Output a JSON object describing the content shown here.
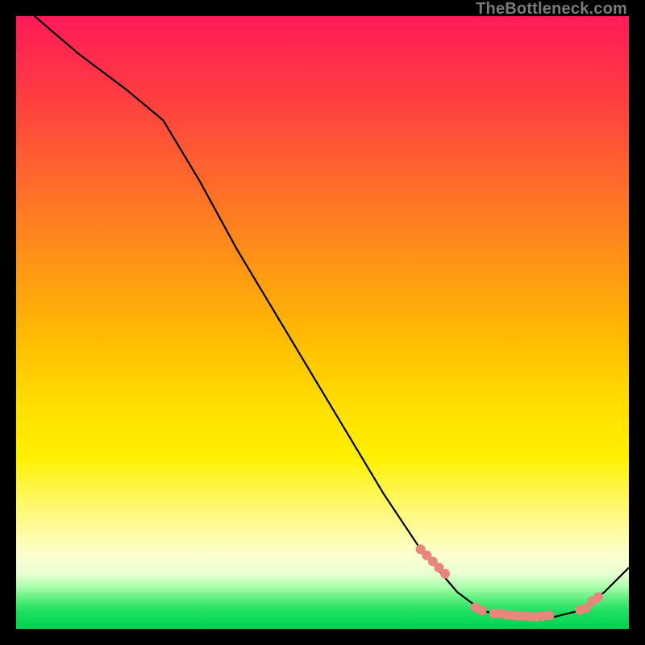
{
  "watermark": "TheBottleneck.com",
  "chart_data": {
    "type": "line",
    "title": "",
    "xlabel": "",
    "ylabel": "",
    "xlim": [
      0,
      100
    ],
    "ylim": [
      0,
      100
    ],
    "series": [
      {
        "name": "curve",
        "x": [
          3,
          10,
          18,
          24,
          30,
          36,
          42,
          48,
          54,
          60,
          66,
          72,
          76,
          80,
          84,
          88,
          92,
          96,
          100
        ],
        "y": [
          100,
          94,
          88,
          83,
          73,
          62,
          52,
          42,
          32,
          22,
          13,
          6,
          3,
          2,
          2,
          2,
          3,
          6,
          10
        ]
      }
    ],
    "markers": {
      "comment": "salmon-colored data points along the curve near the trough",
      "color": "#e9867b",
      "points_x": [
        66,
        67,
        68,
        69,
        70,
        75,
        76,
        78,
        79,
        80,
        81,
        82,
        83,
        84,
        85,
        86,
        87,
        92,
        93,
        94,
        95
      ],
      "points_y": [
        13,
        12,
        11,
        10,
        9,
        3.5,
        3,
        2.5,
        2.5,
        2.3,
        2.2,
        2.1,
        2.1,
        2.0,
        2.0,
        2.1,
        2.2,
        3.1,
        3.4,
        4.5,
        5.2
      ]
    }
  }
}
